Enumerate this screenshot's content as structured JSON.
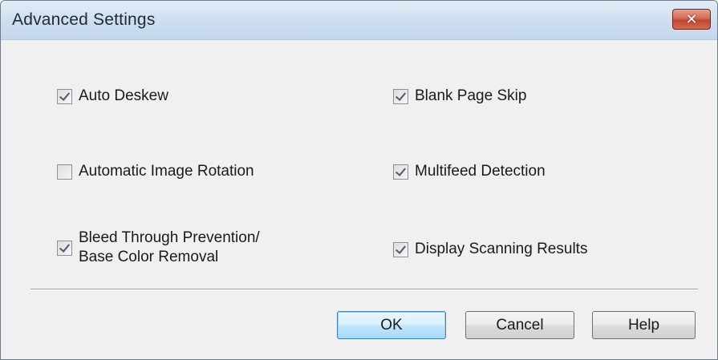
{
  "window": {
    "title": "Advanced Settings",
    "close_glyph": "✕"
  },
  "options": {
    "auto_deskew": {
      "label": "Auto Deskew",
      "checked": true
    },
    "blank_page_skip": {
      "label": "Blank Page Skip",
      "checked": true
    },
    "automatic_image_rotation": {
      "label": "Automatic Image Rotation",
      "checked": false
    },
    "multifeed_detection": {
      "label": "Multifeed Detection",
      "checked": true
    },
    "bleed_through": {
      "label_line1": "Bleed Through Prevention/",
      "label_line2": "Base Color Removal",
      "checked": true
    },
    "display_scanning_results": {
      "label": "Display Scanning Results",
      "checked": true
    }
  },
  "buttons": {
    "ok": "OK",
    "cancel": "Cancel",
    "help": "Help"
  },
  "colors": {
    "title_bar": "#c9dbef",
    "close_button": "#c2462e",
    "default_button_border": "#3c7fb1",
    "dialog_background": "#f0f0f0"
  }
}
